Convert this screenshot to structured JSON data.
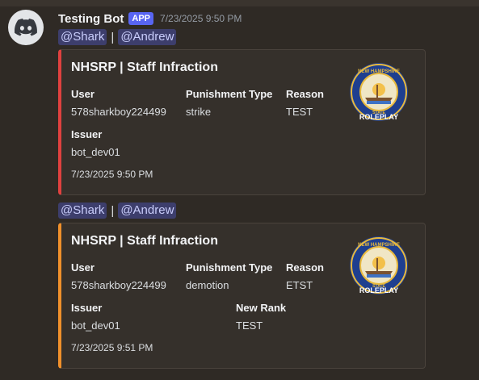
{
  "message": {
    "bot_name": "Testing Bot",
    "badge": "APP",
    "timestamp": "7/23/2025 9:50 PM",
    "colors": {
      "accent_badge": "#5865f2",
      "mention_bg": "#4a4f8a",
      "embed1_bar": "#e0413f",
      "embed2_bar": "#f0902b"
    }
  },
  "mentions1": {
    "m1": "@Shark",
    "sep": "|",
    "m2": "@Andrew"
  },
  "embed1": {
    "title": "NHSRP | Staff Infraction",
    "f_user_name": "User",
    "f_user_value": "578sharkboy224499",
    "f_type_name": "Punishment Type",
    "f_type_value": "strike",
    "f_reason_name": "Reason",
    "f_reason_value": "TEST",
    "f_issuer_name": "Issuer",
    "f_issuer_value": "bot_dev01",
    "footer": "7/23/2025 9:50 PM",
    "thumb_icon": "nhsrp-seal-icon"
  },
  "mentions2": {
    "m1": "@Shark",
    "sep": "|",
    "m2": "@Andrew"
  },
  "embed2": {
    "title": "NHSRP | Staff Infraction",
    "f_user_name": "User",
    "f_user_value": "578sharkboy224499",
    "f_type_name": "Punishment Type",
    "f_type_value": "demotion",
    "f_reason_name": "Reason",
    "f_reason_value": "ETST",
    "f_issuer_name": "Issuer",
    "f_issuer_value": "bot_dev01",
    "f_rank_name": "New Rank",
    "f_rank_value": "TEST",
    "footer": "7/23/2025 9:51 PM",
    "thumb_icon": "nhsrp-seal-icon"
  },
  "seal": {
    "top_text": "NEW HAMPSHIRE",
    "mid_text": "STATE",
    "bottom_text": "ROLEPLAY"
  }
}
